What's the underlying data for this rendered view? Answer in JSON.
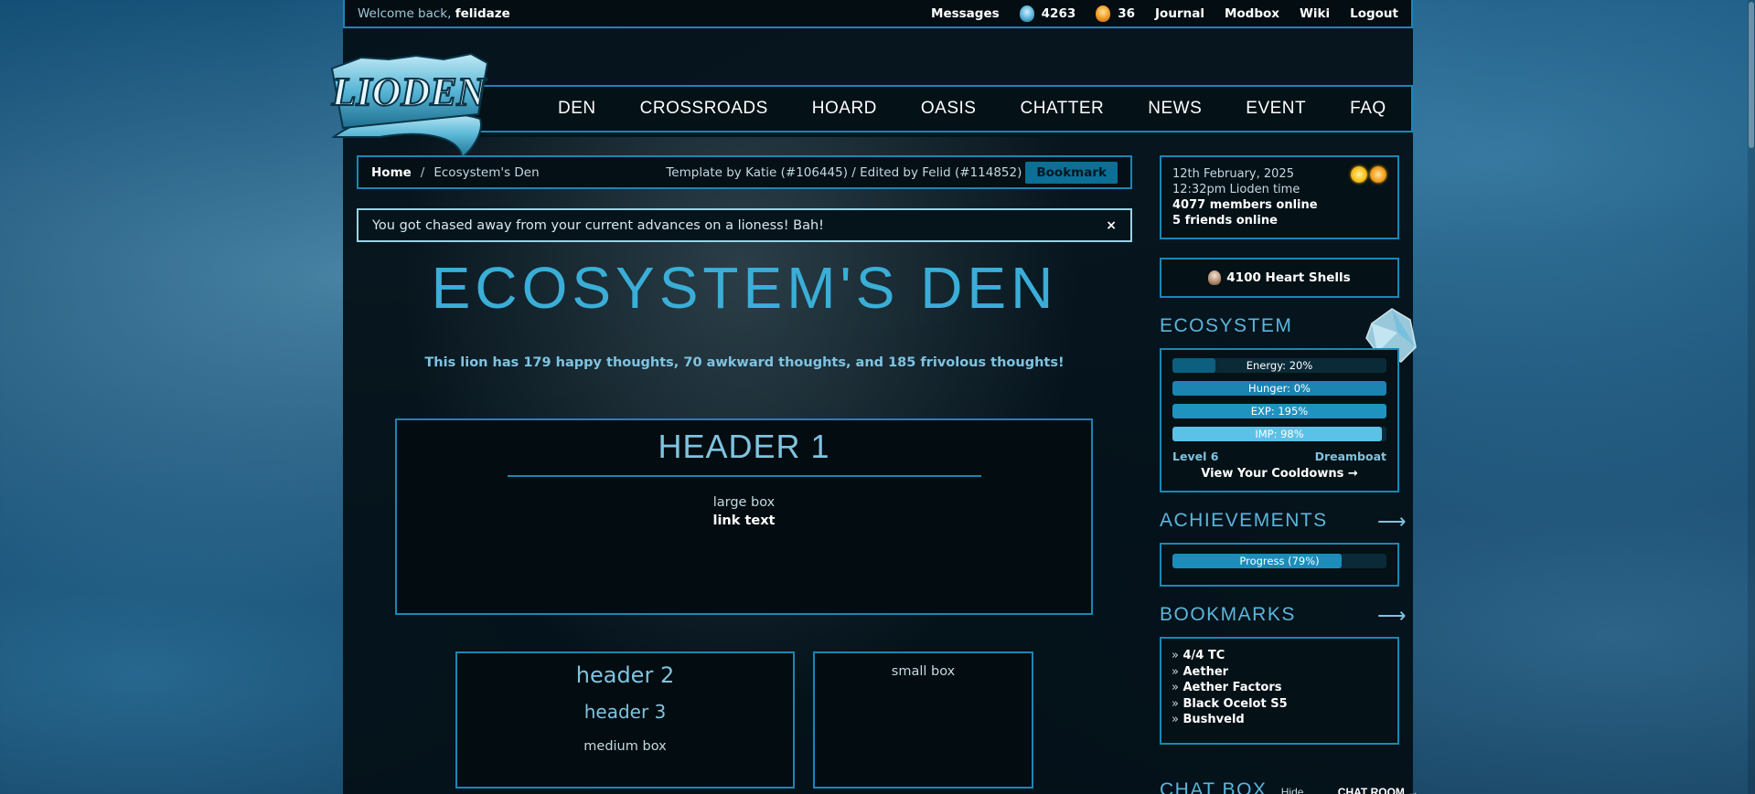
{
  "topbar": {
    "welcome_prefix": "Welcome back,",
    "username": "felidaze",
    "messages": "Messages",
    "currency_blue": "4263",
    "currency_gold": "36",
    "journal": "Journal",
    "modbox": "Modbox",
    "wiki": "Wiki",
    "logout": "Logout"
  },
  "nav": {
    "items": [
      "DEN",
      "CROSSROADS",
      "HOARD",
      "OASIS",
      "CHATTER",
      "NEWS",
      "EVENT",
      "FAQ"
    ]
  },
  "logo": {
    "text": "LIODEN"
  },
  "breadcrumb": {
    "home": "Home",
    "separator": "/",
    "current": "Ecosystem's Den",
    "credit": "Template by Katie (#106445) / Edited by Felid (#114852)",
    "bookmark_button": "Bookmark"
  },
  "alert": {
    "message": "You got chased away from your current advances on a lioness! Bah!",
    "close": "×"
  },
  "den": {
    "title": "ECOSYSTEM'S DEN",
    "thoughts": "This lion has 179 happy thoughts, 70 awkward thoughts, and 185 frivolous thoughts!",
    "large_box": {
      "header": "HEADER 1",
      "text": "large box",
      "link": "link text"
    },
    "medium_box": {
      "header2": "header 2",
      "header3": "header 3",
      "text": "medium box"
    },
    "small_box": {
      "text": "small box"
    }
  },
  "sidebar": {
    "date": "12th February, 2025",
    "time": "12:32pm Lioden time",
    "members_online": "4077 members online",
    "friends_online": "5 friends online",
    "heart_shells": "4100 Heart Shells",
    "lion_title": "ECOSYSTEM",
    "stats": [
      {
        "label": "Energy: 20%",
        "percent": 20,
        "color": "#0d5f80"
      },
      {
        "label": "Hunger: 0%",
        "percent": 100,
        "color": "#1b84b0"
      },
      {
        "label": "EXP: 195%",
        "percent": 100,
        "color": "#1f93bf"
      },
      {
        "label": "IMP: 98%",
        "percent": 98,
        "color": "#5cc1e6"
      }
    ],
    "level": "Level 6",
    "rank": "Dreamboat",
    "cooldowns": "View Your Cooldowns →",
    "achievements_title": "ACHIEVEMENTS",
    "achievements_progress": {
      "label": "Progress (79%)",
      "percent": 79,
      "color": "#1b8dbb"
    },
    "bookmarks_title": "BOOKMARKS",
    "arrow": "⟶",
    "bookmarks": [
      "4/4 TC",
      "Aether",
      "Aether Factors",
      "Black Ocelot S5",
      "Bushveld"
    ],
    "bookmark_prefix": "»",
    "chatbox_title": "CHAT BOX",
    "chatbox_hide": "Hide",
    "chatbox_room": "CHAT ROOM →"
  }
}
